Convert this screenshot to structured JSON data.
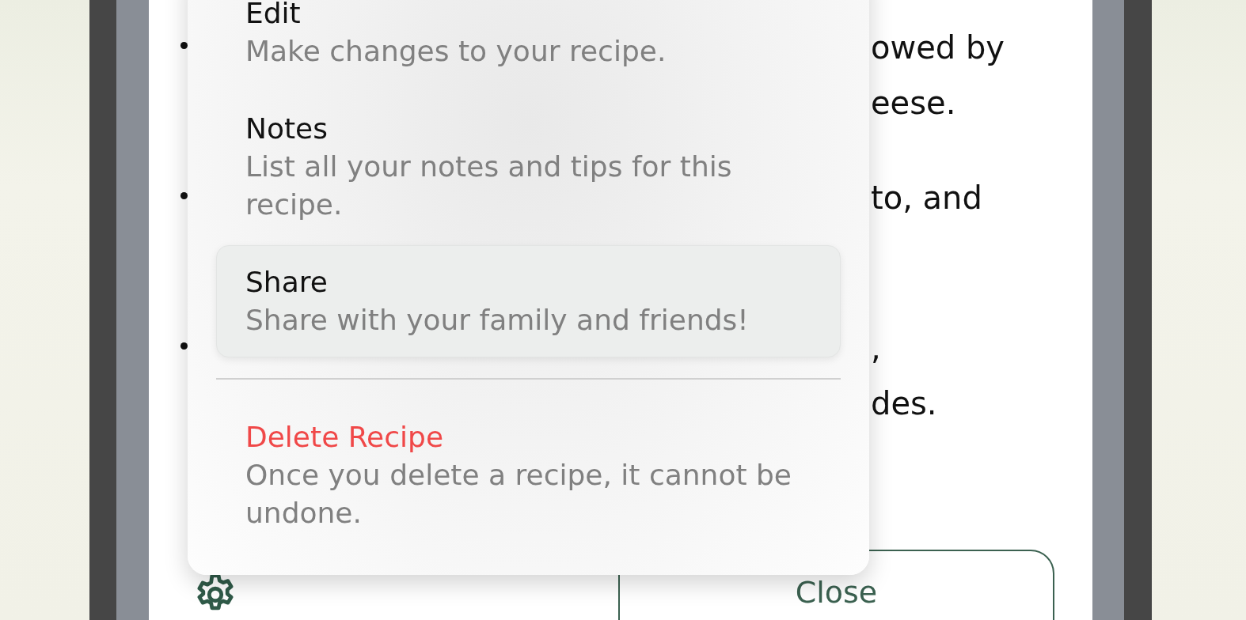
{
  "recipe_steps": [
    {
      "lines": [
        "owed by",
        "eese."
      ]
    },
    {
      "lines": [
        "to, and"
      ]
    },
    {
      "lines": [
        ",",
        "des."
      ]
    }
  ],
  "menu": {
    "items": [
      {
        "kind": "action",
        "title": "Edit",
        "description": "Make changes to your recipe.",
        "selected": false
      },
      {
        "kind": "action",
        "title": "Notes",
        "description": "List all your notes and tips for this recipe.",
        "selected": false
      },
      {
        "kind": "action",
        "title": "Share",
        "description": "Share with your family and friends!",
        "selected": true
      },
      {
        "kind": "separator"
      },
      {
        "kind": "destructive",
        "title": "Delete Recipe",
        "description": "Once you delete a recipe, it cannot be undone.",
        "selected": false
      }
    ]
  },
  "close_button": {
    "label": "Close"
  }
}
